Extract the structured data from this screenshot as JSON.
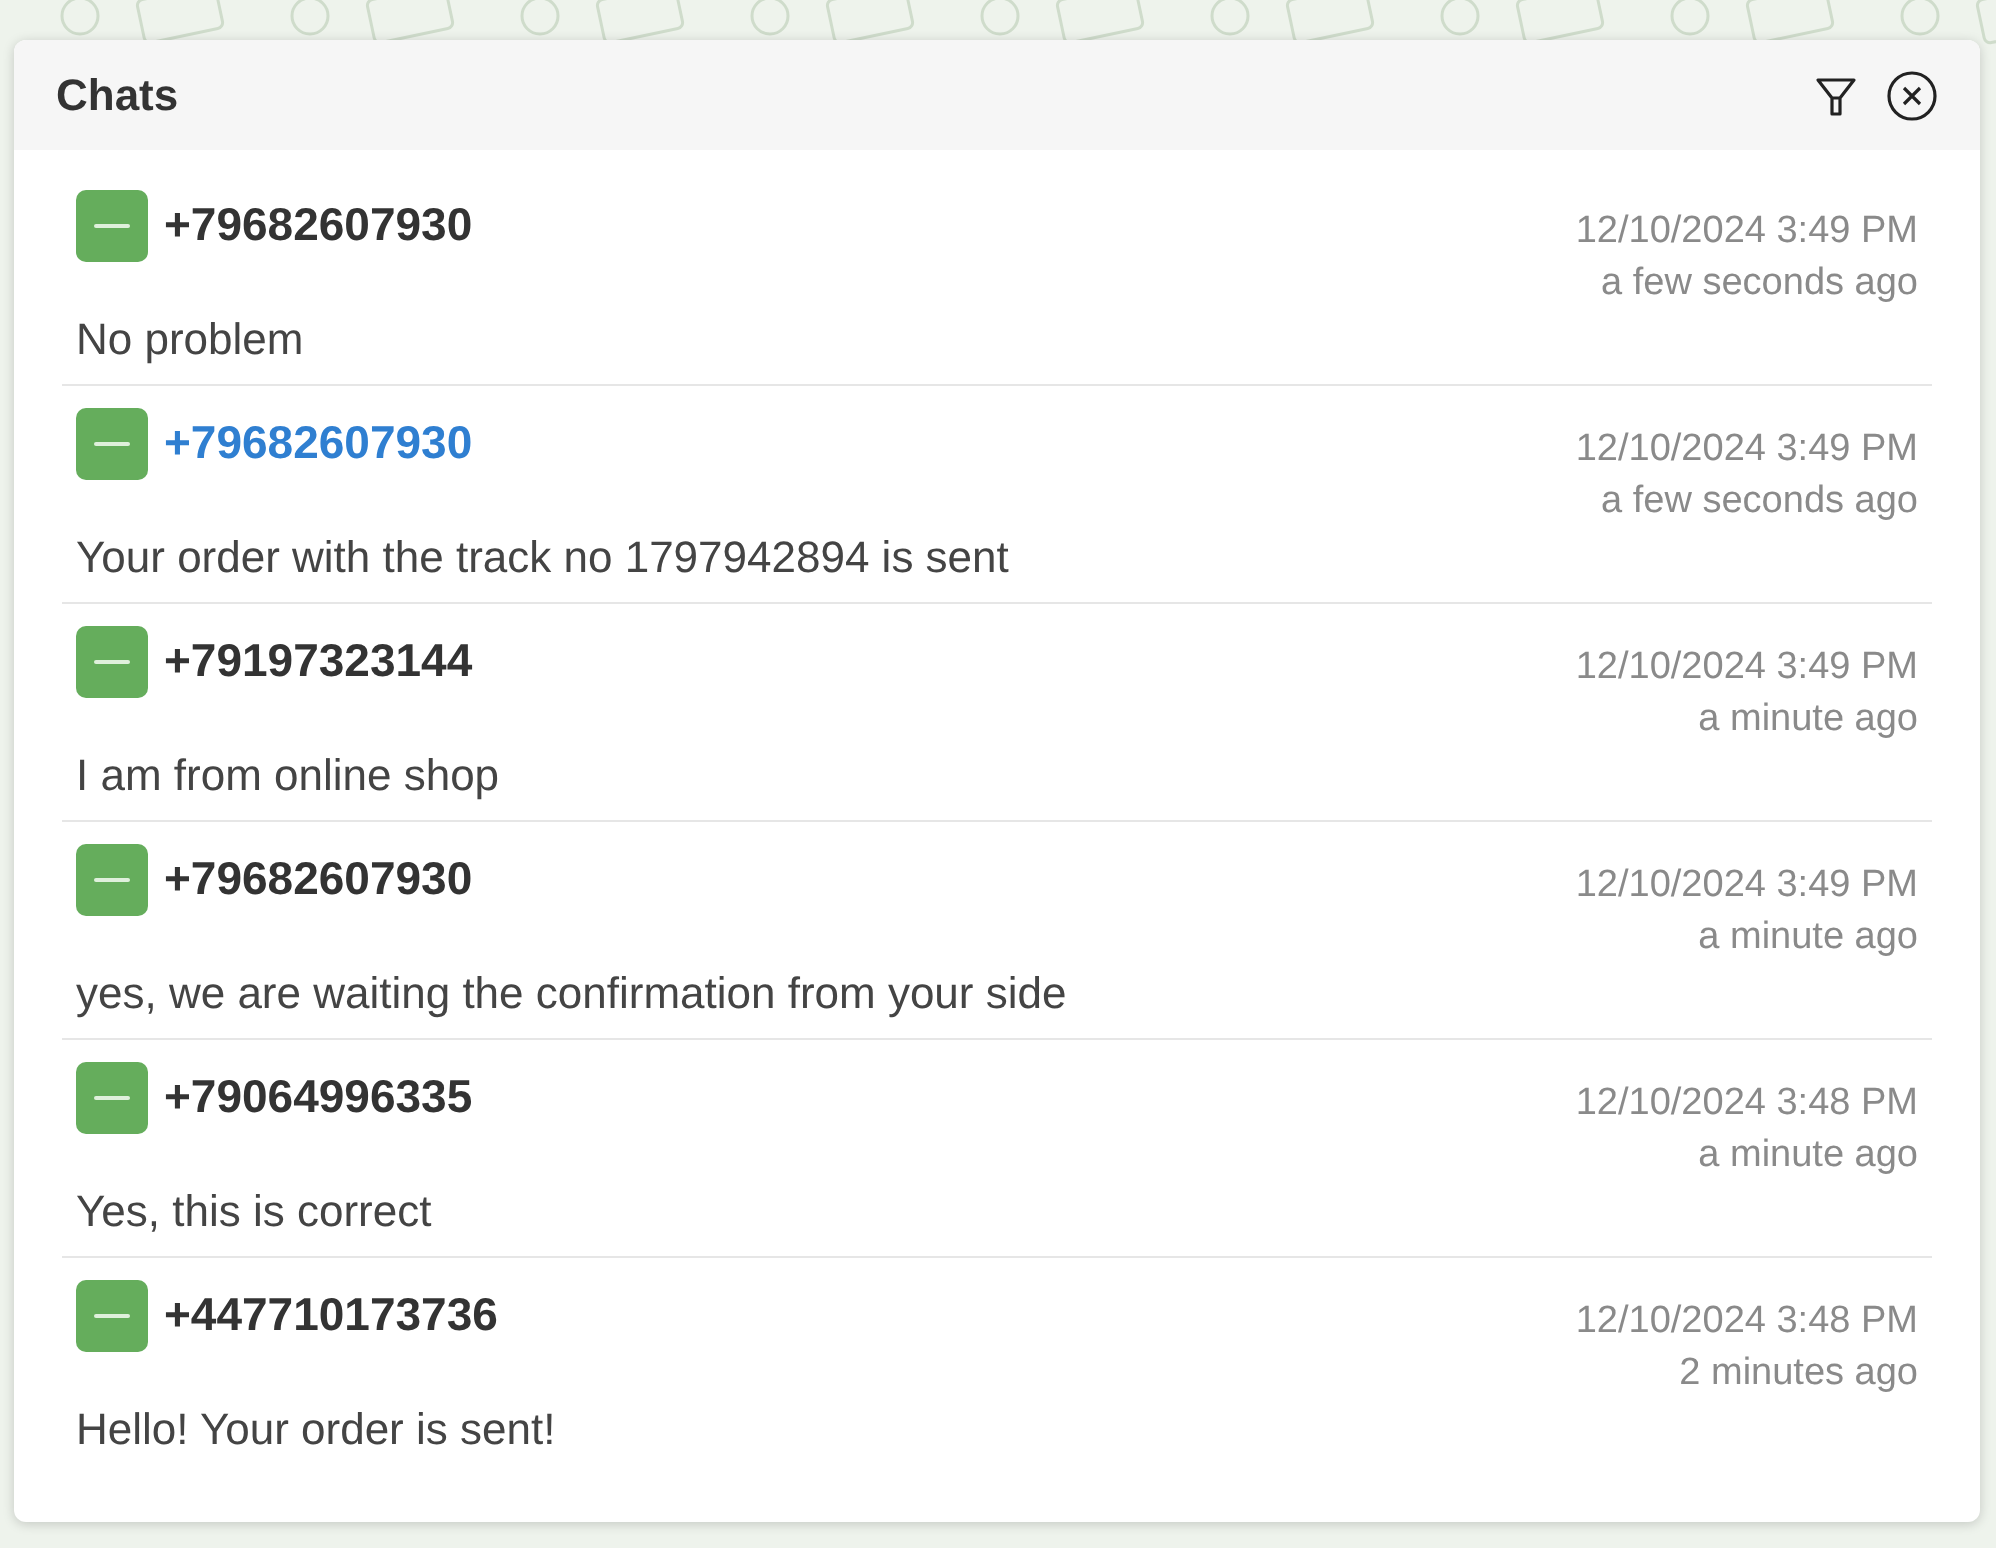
{
  "panel": {
    "title": "Chats"
  },
  "chats": [
    {
      "phone": "+79682607930",
      "selected": false,
      "date": "12/10/2024 3:49 PM",
      "ago": "a few seconds ago",
      "message": "No problem"
    },
    {
      "phone": "+79682607930",
      "selected": true,
      "date": "12/10/2024 3:49 PM",
      "ago": "a few seconds ago",
      "message": "Your order with the track no 1797942894 is sent"
    },
    {
      "phone": "+79197323144",
      "selected": false,
      "date": "12/10/2024 3:49 PM",
      "ago": "a minute ago",
      "message": "I am from online shop"
    },
    {
      "phone": "+79682607930",
      "selected": false,
      "date": "12/10/2024 3:49 PM",
      "ago": "a minute ago",
      "message": "yes, we are waiting the confirmation from your side"
    },
    {
      "phone": "+79064996335",
      "selected": false,
      "date": "12/10/2024 3:48 PM",
      "ago": "a minute ago",
      "message": "Yes, this is correct"
    },
    {
      "phone": "+447710173736",
      "selected": false,
      "date": "12/10/2024 3:48 PM",
      "ago": "2 minutes ago",
      "message": "Hello! Your order is sent!"
    }
  ]
}
